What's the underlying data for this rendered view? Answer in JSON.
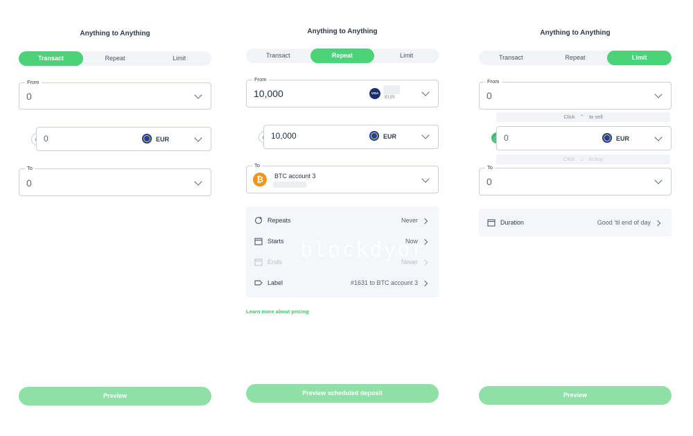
{
  "panels": [
    {
      "title": "Anything to Anything",
      "tabs": [
        "Transact",
        "Repeat",
        "Limit"
      ],
      "from": {
        "label": "From",
        "value": "0"
      },
      "convert": {
        "value": "0",
        "currency": "EUR"
      },
      "to": {
        "label": "To",
        "value": "0"
      },
      "button": "Preview"
    },
    {
      "title": "Anything to Anything",
      "tabs": [
        "Transact",
        "Repeat",
        "Limit"
      ],
      "from": {
        "label": "From",
        "value": "10,000",
        "card": "VISA",
        "currency_sub": "EUR"
      },
      "convert": {
        "value": "10,000",
        "currency": "EUR"
      },
      "to": {
        "label": "To",
        "account": "BTC account 3",
        "icon": "₿"
      },
      "options": [
        {
          "label": "Repeats",
          "value": "Never"
        },
        {
          "label": "Starts",
          "value": "Now"
        },
        {
          "label": "Ends",
          "value": "Never"
        },
        {
          "label": "Label",
          "value": "#1631 to BTC account 3"
        }
      ],
      "watermark": "blockdyor",
      "link": "Learn more about pricing",
      "button": "Preview scheduled deposit"
    },
    {
      "title": "Anything to Anything",
      "tabs": [
        "Transact",
        "Repeat",
        "Limit"
      ],
      "from": {
        "label": "From",
        "value": "0"
      },
      "hint_sell": {
        "pre": "Click",
        "post": "to sell"
      },
      "convert": {
        "value": "0",
        "currency": "EUR"
      },
      "hint_buy": {
        "pre": "Click",
        "post": "to buy"
      },
      "to": {
        "label": "To",
        "value": "0"
      },
      "duration": {
        "label": "Duration",
        "value": "Good 'til end of day"
      },
      "button": "Preview"
    }
  ],
  "colors": {
    "accent": "#4cd37a",
    "button_disabled": "#8fe0a6",
    "link": "#3cc46c"
  }
}
